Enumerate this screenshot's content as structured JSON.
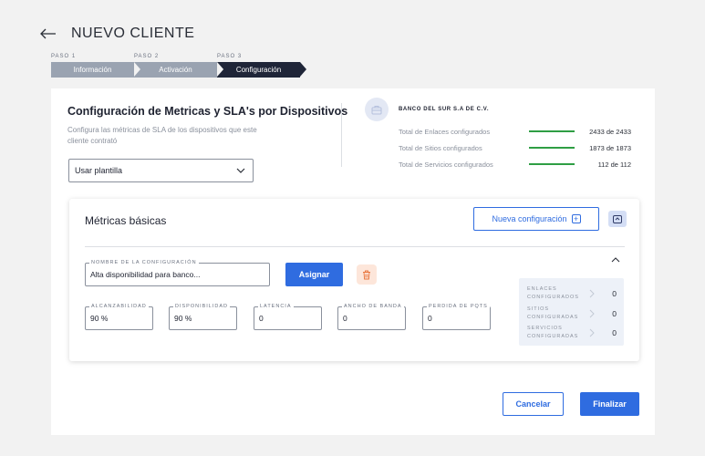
{
  "header": {
    "title": "NUEVO CLIENTE"
  },
  "stepper": {
    "steps": [
      {
        "caption": "PASO 1",
        "label": "Información"
      },
      {
        "caption": "PASO 2",
        "label": "Activación"
      },
      {
        "caption": "PASO 3",
        "label": "Configuración"
      }
    ],
    "active_step": 3
  },
  "config": {
    "title": "Configuración de Metricas y SLA's por Dispositivos",
    "description": "Configura las métricas de SLA de los dispositivos que este cliente contrató",
    "template_select": "Usar plantilla"
  },
  "bank": {
    "name": "BANCO DEL SUR S.A DE C.V.",
    "stats": [
      {
        "label": "Total de Enlaces configurados",
        "value": "2433 de 2433",
        "progress": 1.0
      },
      {
        "label": "Total de Sitios configurados",
        "value": "1873 de 1873",
        "progress": 1.0
      },
      {
        "label": "Total de Servicios configurados",
        "value": "112 de 112",
        "progress": 1.0
      }
    ]
  },
  "metrics": {
    "title": "Métricas básicas",
    "new_config_label": "Nueva configuración",
    "config_name": {
      "label": "NOMBRE DE LA CONFIGURACIÓN",
      "value": "Alta disponibilidad para banco..."
    },
    "assign_label": "Asignar",
    "fields": [
      {
        "label": "ALCANZABILIDAD",
        "value": "90 %"
      },
      {
        "label": "DISPONIBILIDAD",
        "value": "90 %"
      },
      {
        "label": "LATENCIA",
        "value": "0"
      },
      {
        "label": "ANCHO DE BANDA",
        "value": "0"
      },
      {
        "label": "PERDIDA DE PQTS",
        "value": "0"
      }
    ],
    "summary": [
      {
        "label": "ENLACES CONFIGURADOS",
        "value": "0"
      },
      {
        "label": "SITIOS CONFIGURADAS",
        "value": "0"
      },
      {
        "label": "SERVICIOS CONFIGURADAS",
        "value": "0"
      }
    ]
  },
  "footer": {
    "cancel_label": "Cancelar",
    "finish_label": "Finalizar"
  },
  "colors": {
    "primary": "#2f6ce0",
    "progress": "#2f9e44",
    "step_done": "#9aa3b1",
    "step_active": "#1f2538",
    "danger_bg": "#fde6da",
    "danger": "#e8743b"
  }
}
